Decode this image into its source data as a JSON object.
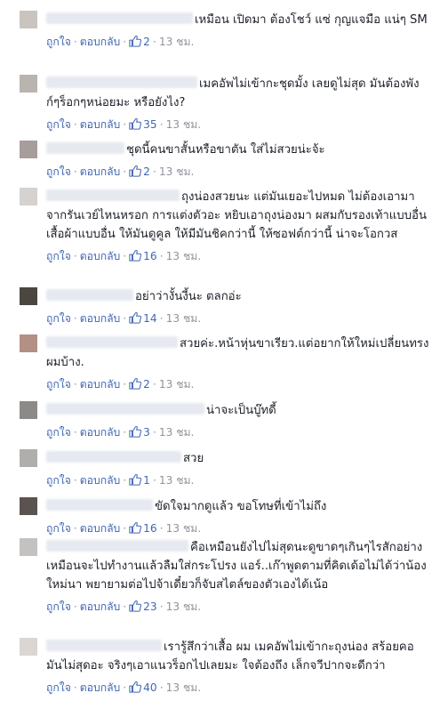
{
  "actions": {
    "like_label": "ถูกใจ",
    "reply_label": "ตอบกลับ",
    "dot": "·"
  },
  "comments": [
    {
      "text": "เหมือน เปิดมา ต้องโชว์ แซ่ กุญแจมือ แน่ๆ SM",
      "likes": "2",
      "time": "13 ชม."
    },
    {
      "text": "เมคอัพไม่เข้ากะชุดมั้ง เลยดูไม่สุด มันต้องพังก์ๆร็อกๆหน่อยมะ หรือยังไง?",
      "likes": "35",
      "time": "13 ชม."
    },
    {
      "text": "ชุดนี้คนขาสั้นหรือขาตัน ใส่ไม่สวยน่ะจ้ะ",
      "likes": "2",
      "time": "13 ชม."
    },
    {
      "text": "ถุงน่องสวยนะ แต่มันเยอะไปหมด ไม่ต้องเอามาจากรันเวย์ไหนหรอก การแต่งตัวอะ หยิบเอาถุงน่องมา ผสมกับรองเท้าแบบอื่น เสื้อผ้าแบบอื่น ให้มันดูคูล ให้มีมันชิคกว่านี้ ให้ซอฟต์กว่านี้ น่าจะโอกวส",
      "likes": "16",
      "time": "13 ชม."
    },
    {
      "text": "อย่าว่างั้นงี้นะ ตลกอ่ะ",
      "likes": "14",
      "time": "13 ชม."
    },
    {
      "text": "สวยค่ะ.หน้าหุ่นขาเรียว.แต่อยากให้ใหม่เปลี่ยนทรงผมบ้าง.",
      "likes": "2",
      "time": "13 ชม."
    },
    {
      "text": "น่าจะเป็นบู๊ทดี้",
      "likes": "3",
      "time": "13 ชม."
    },
    {
      "text": "สวย",
      "likes": "1",
      "time": "13 ชม."
    },
    {
      "text": "ขัดใจมากดูแล้ว ขอโทษที่เข้าไม่ถึง",
      "likes": "16",
      "time": "13 ชม."
    },
    {
      "text": "คือเหมือนยังไปไม่สุดนะดูขาดๆเกินๆไรสักอย่าง เหมือนจะไปทำงานแล้วลืมใส่กระโปรง แอร์..เก๊าพูดตามที่คิดเด้อไม่ได้ว่าน้องใหม่นา พยายามต่อไปจ้าเดี๋ยวก็จับสไตล์ของตัวเองได้เน้อ",
      "likes": "23",
      "time": "13 ชม."
    },
    {
      "text": "เรารู้สึกว่าเสื้อ ผม เมคอัพไม่เข้ากะถุงน่อง สร้อยคอ มันไม่สุดอะ จริงๆเอาแนวร็อกไปเลยมะ ใจต้องถึง เล็กจวีปากจะดีกว่า",
      "likes": "40",
      "time": "13 ชม."
    }
  ]
}
